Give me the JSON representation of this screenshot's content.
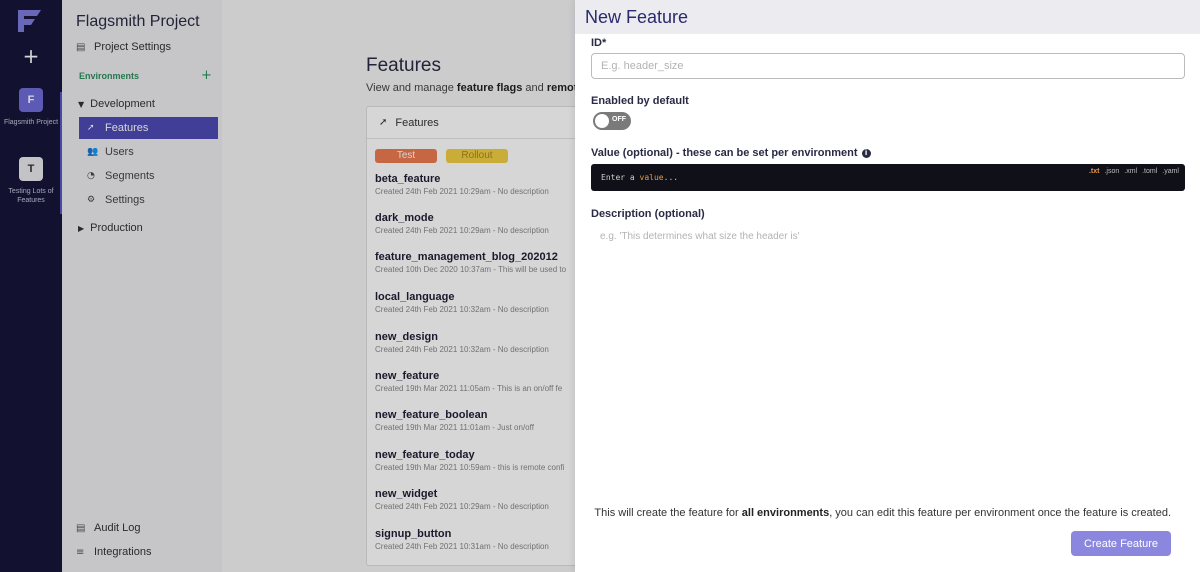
{
  "rail": {
    "projects": [
      {
        "initial": "F",
        "name": "Flagsmith Project"
      },
      {
        "initial": "T",
        "name": "Testing Lots of Features"
      }
    ]
  },
  "sidebar": {
    "project_name": "Flagsmith Project",
    "project_settings": "Project Settings",
    "environments_label": "Environments",
    "development": "Development",
    "dev_items": [
      "Features",
      "Users",
      "Segments",
      "Settings"
    ],
    "production": "Production",
    "audit_log": "Audit Log",
    "integrations": "Integrations"
  },
  "main": {
    "title": "Features",
    "subtitle_pre": "View and manage ",
    "subtitle_b1": "feature flags",
    "subtitle_mid": " and ",
    "subtitle_b2": "remote",
    "panel_title": "Features",
    "tags": [
      "Test",
      "Rollout"
    ],
    "features": [
      {
        "name": "beta_feature",
        "desc": "Created 24th Feb 2021 10:29am - No description"
      },
      {
        "name": "dark_mode",
        "desc": "Created 24th Feb 2021 10:29am - No description"
      },
      {
        "name": "feature_management_blog_202012",
        "desc": "Created 10th Dec 2020 10:37am - This will be used to"
      },
      {
        "name": "local_language",
        "desc": "Created 24th Feb 2021 10:32am - No description"
      },
      {
        "name": "new_design",
        "desc": "Created 24th Feb 2021 10:32am - No description"
      },
      {
        "name": "new_feature",
        "desc": "Created 19th Mar 2021 11:05am - This is an on/off fe"
      },
      {
        "name": "new_feature_boolean",
        "desc": "Created 19th Mar 2021 11:01am - Just on/off"
      },
      {
        "name": "new_feature_today",
        "desc": "Created 19th Mar 2021 10:59am - this is remote confi"
      },
      {
        "name": "new_widget",
        "desc": "Created 24th Feb 2021 10:29am - No description"
      },
      {
        "name": "signup_button",
        "desc": "Created 24th Feb 2021 10:31am - No description"
      }
    ]
  },
  "drawer": {
    "title": "New Feature",
    "id_label": "ID*",
    "id_placeholder": "E.g. header_size",
    "enabled_label": "Enabled by default",
    "toggle_text": "OFF",
    "value_label": "Value (optional) - these can be set per environment",
    "value_placeholder_pre": "Enter a ",
    "value_placeholder_kw": "value",
    "value_placeholder_post": "...",
    "formats": [
      ".txt",
      ".json",
      ".xml",
      ".toml",
      ".yaml"
    ],
    "desc_label": "Description (optional)",
    "desc_placeholder": "e.g. 'This determines what size the header is'",
    "note_pre": "This will create the feature for ",
    "note_bold": "all environments",
    "note_post": ", you can edit this feature per environment once the feature is created.",
    "create_button": "Create Feature"
  },
  "colors": {
    "rail_bg": "#16163a",
    "accent": "#4e4bb5",
    "button": "#8b87de",
    "env_green": "#2f8f5e",
    "tag_test": "#ee7a4f",
    "tag_rollout": "#f1cf45"
  }
}
